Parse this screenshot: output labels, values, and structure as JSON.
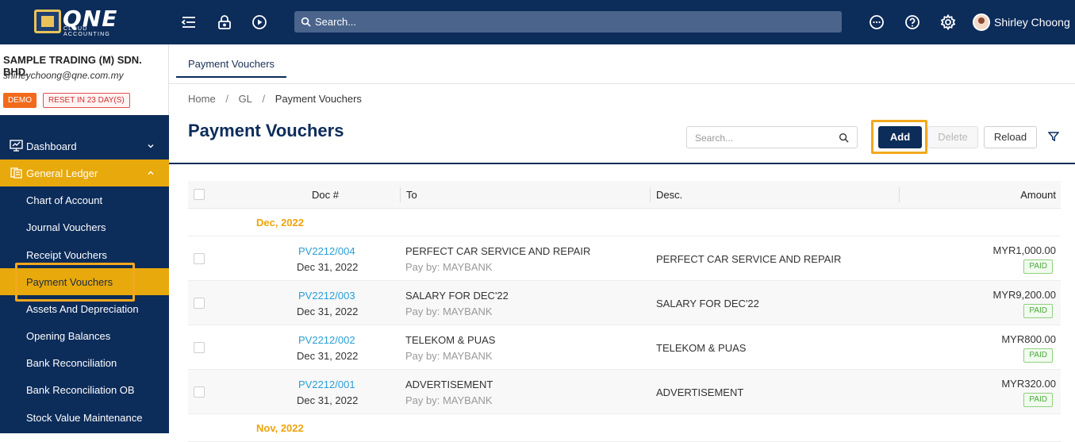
{
  "app": {
    "logo_text": "QNE",
    "logo_sub": "CLOUD ACCOUNTING",
    "search_placeholder": "Search...",
    "user_name": "Shirley Choong"
  },
  "account": {
    "company": "SAMPLE TRADING (M) SDN. BHD.",
    "email": "shirleychoong@qne.com.my",
    "demo_badge": "DEMO",
    "reset_badge": "RESET IN 23 DAY(S)"
  },
  "sidebar": {
    "items": [
      {
        "label": "Dashboard"
      },
      {
        "label": "General Ledger"
      },
      {
        "label": "Chart of Account"
      },
      {
        "label": "Journal Vouchers"
      },
      {
        "label": "Receipt Vouchers"
      },
      {
        "label": "Payment Vouchers"
      },
      {
        "label": "Assets And Depreciation"
      },
      {
        "label": "Opening Balances"
      },
      {
        "label": "Bank Reconciliation"
      },
      {
        "label": "Bank Reconciliation OB"
      },
      {
        "label": "Stock Value Maintenance"
      }
    ]
  },
  "tabs": [
    {
      "label": "Payment Vouchers"
    }
  ],
  "breadcrumb": {
    "home": "Home",
    "section": "GL",
    "current": "Payment Vouchers"
  },
  "page": {
    "title": "Payment Vouchers",
    "search_placeholder": "Search...",
    "add_label": "Add",
    "delete_label": "Delete",
    "reload_label": "Reload"
  },
  "table": {
    "columns": [
      "Doc #",
      "To",
      "Desc.",
      "Amount"
    ],
    "groups": [
      {
        "label": "Dec, 2022",
        "rows": [
          {
            "doc": "PV2212/004",
            "date": "Dec 31, 2022",
            "to": "PERFECT CAR SERVICE AND REPAIR",
            "pay_by": "Pay by: MAYBANK",
            "desc": "PERFECT CAR SERVICE AND REPAIR",
            "amount": "MYR1,000.00",
            "status": "PAID"
          },
          {
            "doc": "PV2212/003",
            "date": "Dec 31, 2022",
            "to": "SALARY FOR DEC'22",
            "pay_by": "Pay by: MAYBANK",
            "desc": "SALARY FOR DEC'22",
            "amount": "MYR9,200.00",
            "status": "PAID"
          },
          {
            "doc": "PV2212/002",
            "date": "Dec 31, 2022",
            "to": "TELEKOM & PUAS",
            "pay_by": "Pay by: MAYBANK",
            "desc": "TELEKOM & PUAS",
            "amount": "MYR800.00",
            "status": "PAID"
          },
          {
            "doc": "PV2212/001",
            "date": "Dec 31, 2022",
            "to": "ADVERTISEMENT",
            "pay_by": "Pay by: MAYBANK",
            "desc": "ADVERTISEMENT",
            "amount": "MYR320.00",
            "status": "PAID"
          }
        ]
      },
      {
        "label": "Nov, 2022",
        "rows": []
      }
    ]
  },
  "colors": {
    "navy": "#0c2c5a",
    "accent": "#e8a90c",
    "link": "#2a9fd6",
    "paid": "#49a838"
  }
}
